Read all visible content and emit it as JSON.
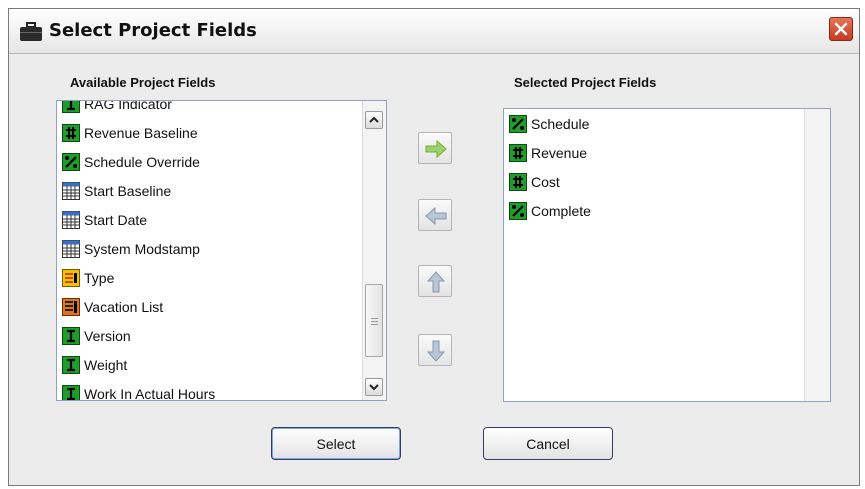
{
  "window": {
    "title": "Select Project Fields"
  },
  "available": {
    "label": "Available Project Fields",
    "items": [
      {
        "label": "RAG Indicator",
        "icon": "text-field-icon"
      },
      {
        "label": "Revenue Baseline",
        "icon": "currency-field-icon"
      },
      {
        "label": "Schedule Override",
        "icon": "percent-field-icon"
      },
      {
        "label": "Start Baseline",
        "icon": "date-field-icon"
      },
      {
        "label": "Start Date",
        "icon": "date-field-icon"
      },
      {
        "label": "System Modstamp",
        "icon": "date-field-icon"
      },
      {
        "label": "Type",
        "icon": "picklist-field-icon"
      },
      {
        "label": "Vacation List",
        "icon": "multi-picklist-field-icon"
      },
      {
        "label": "Version",
        "icon": "text-field-icon"
      },
      {
        "label": "Weight",
        "icon": "text-field-icon"
      },
      {
        "label": "Work In Actual Hours",
        "icon": "text-field-icon"
      }
    ]
  },
  "selected": {
    "label": "Selected Project Fields",
    "items": [
      {
        "label": "Schedule",
        "icon": "percent-field-icon"
      },
      {
        "label": "Revenue",
        "icon": "currency-field-icon"
      },
      {
        "label": "Cost",
        "icon": "currency-field-icon"
      },
      {
        "label": "Complete",
        "icon": "percent-field-icon"
      }
    ]
  },
  "move_buttons": [
    {
      "name": "move-right-button",
      "icon": "arrow-right-icon"
    },
    {
      "name": "move-left-button",
      "icon": "arrow-left-icon"
    },
    {
      "name": "move-up-button",
      "icon": "arrow-up-icon"
    },
    {
      "name": "move-down-button",
      "icon": "arrow-down-icon"
    }
  ],
  "buttons": {
    "select": "Select",
    "cancel": "Cancel"
  },
  "colors": {
    "field_green": "#1f9d2a",
    "field_orange": "#e0741e",
    "field_yellow": "#f2c400",
    "date_blue": "#3a6fc4",
    "arrow_green": "#9fd36a",
    "arrow_grey": "#9aa9ba"
  }
}
